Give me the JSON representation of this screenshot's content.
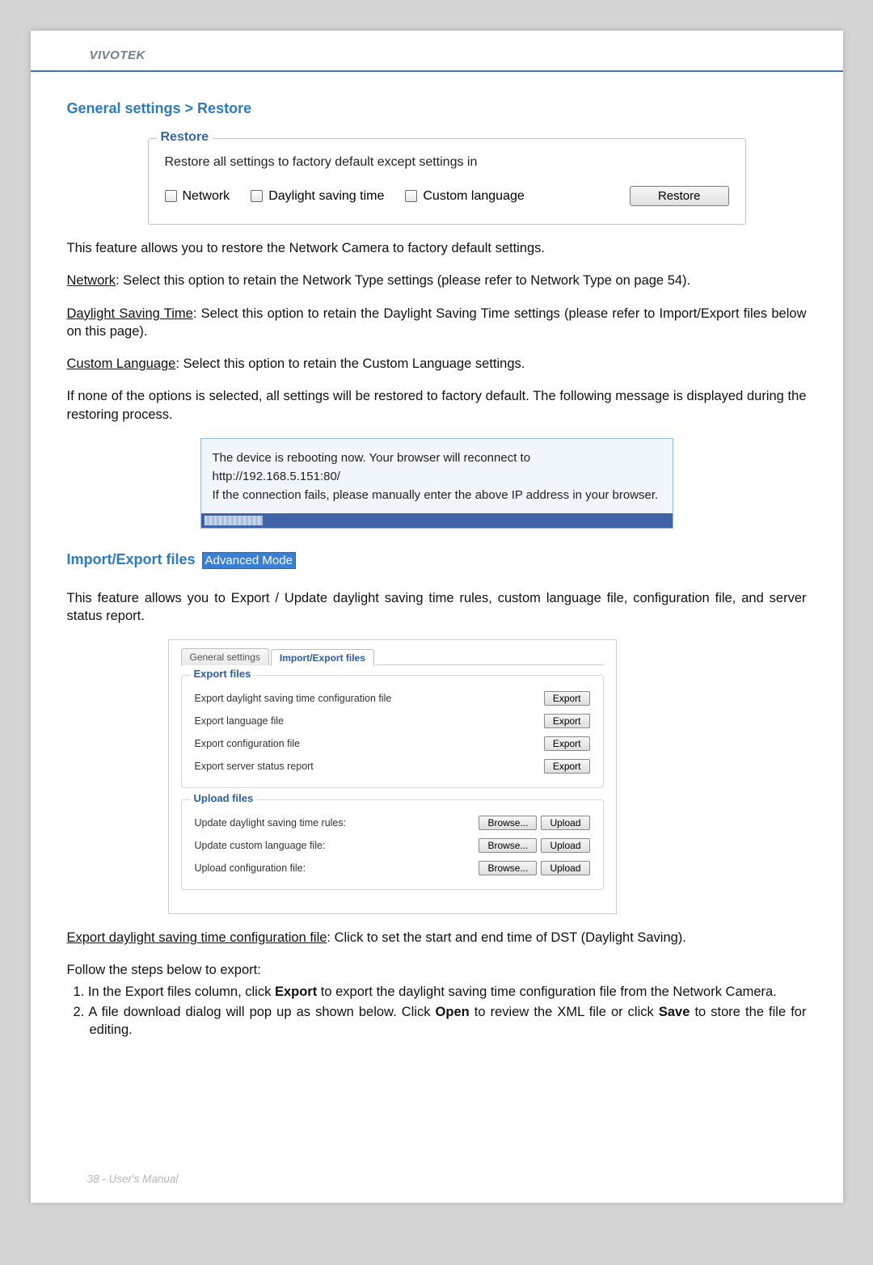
{
  "header": {
    "brand": "VIVOTEK"
  },
  "section1": {
    "title": "General settings > Restore"
  },
  "restore_box": {
    "legend": "Restore",
    "instruction": "Restore all settings to factory default except settings in",
    "cb_network": "Network",
    "cb_dst": "Daylight saving time",
    "cb_lang": "Custom language",
    "button": "Restore"
  },
  "para_intro": "This feature allows you to restore the Network Camera to factory default settings.",
  "para_network_label": "Network",
  "para_network_text": ": Select this option to retain the Network Type settings (please refer to Network Type on page 54).",
  "para_dst_label": "Daylight Saving Time",
  "para_dst_text": ": Select this option to retain the Daylight Saving Time settings (please refer to Import/Export files below on this page).",
  "para_lang_label": "Custom Language",
  "para_lang_text": ": Select this option to retain the Custom Language settings.",
  "para_none": "If none of the options is selected, all settings will be restored to factory default.  The following message is displayed during the restoring process.",
  "reboot_msg_1": "The device is rebooting now. Your browser will reconnect to http://192.168.5.151:80/",
  "reboot_msg_2": "If the connection fails, please manually enter the above IP address in your browser.",
  "section2": {
    "title": "Import/Export files",
    "badge": "Advanced Mode"
  },
  "para_ie_intro": "This feature allows you to Export / Update daylight saving time rules, custom language file, configuration file, and server status report.",
  "tabs": {
    "general": "General settings",
    "import_export": "Import/Export files"
  },
  "export_fs": {
    "legend": "Export files",
    "rows": [
      {
        "label": "Export daylight saving time configuration file",
        "btn": "Export"
      },
      {
        "label": "Export language file",
        "btn": "Export"
      },
      {
        "label": "Export configuration file",
        "btn": "Export"
      },
      {
        "label": "Export server status report",
        "btn": "Export"
      }
    ]
  },
  "upload_fs": {
    "legend": "Upload files",
    "rows": [
      {
        "label": "Update daylight saving time rules:",
        "browse": "Browse...",
        "upload": "Upload"
      },
      {
        "label": "Update custom language file:",
        "browse": "Browse...",
        "upload": "Upload"
      },
      {
        "label": "Upload configuration file:",
        "browse": "Browse...",
        "upload": "Upload"
      }
    ]
  },
  "export_dst_label": "Export daylight saving time configuration file",
  "export_dst_text": ": Click to set the start and end time of DST (Daylight Saving).",
  "follow_steps": "Follow the steps below to export:",
  "step1_pre": "1. In the Export files column, click ",
  "step1_bold": "Export",
  "step1_post": " to export the daylight saving time configuration file from the Network Camera.",
  "step2_pre": "2. A file download dialog will pop up as shown below. Click ",
  "step2_bold1": "Open",
  "step2_mid": " to review the XML file or click ",
  "step2_bold2": "Save",
  "step2_post": " to store the file for editing.",
  "footer": "38 - User's Manual"
}
